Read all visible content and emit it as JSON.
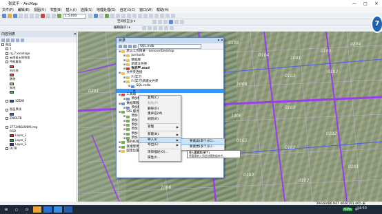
{
  "window": {
    "title": "张武平 - ArcMap",
    "minimize": "—",
    "maximize": "□",
    "close": "✕"
  },
  "menubar": [
    "文件(F)",
    "编辑(E)",
    "视图(V)",
    "书签(B)",
    "插入(I)",
    "选择(S)",
    "地理处理(G)",
    "自定义(C)",
    "窗口(W)",
    "帮助(H)"
  ],
  "toolbar": {
    "scale": "1:5,000",
    "spatial_adjust": "空间校正(J) ▾",
    "georef": "编辑器(R) ▾"
  },
  "toc": {
    "title": "内容列表",
    "layers": [
      {
        "label": "图层",
        "level": 0,
        "swatch": null
      },
      {
        "label": "1",
        "level": 1,
        "swatch": null
      },
      {
        "label": "rq_7.xxxxlogo",
        "level": 1,
        "swatch": null
      },
      {
        "label": "云南省土地利用",
        "level": 1,
        "swatch": null
      },
      {
        "label": "不能重描",
        "level": 1,
        "swatch": null
      },
      {
        "label": "",
        "level": 2,
        "swatch": "#e05050"
      },
      {
        "label": "村庄地",
        "level": 2,
        "swatch": null
      },
      {
        "label": "",
        "level": 2,
        "swatch": "#e05050"
      },
      {
        "label": "耕地",
        "level": 2,
        "swatch": null
      },
      {
        "label": "",
        "level": 2,
        "swatch": "#a0d070"
      },
      {
        "label": "林地",
        "level": 2,
        "swatch": null
      },
      {
        "label": "",
        "level": 2,
        "swatch": "#50b050"
      },
      {
        "label": "",
        "level": 2,
        "swatch": null
      },
      {
        "label": "XZDW",
        "level": 1,
        "swatch": "#2050c0"
      },
      {
        "label": "",
        "level": 2,
        "swatch": null
      },
      {
        "label": "图层界线",
        "level": 1,
        "swatch": null
      },
      {
        "label": "",
        "level": 2,
        "swatch": "#3060d0"
      },
      {
        "label": "ZWDLTB",
        "level": 1,
        "swatch": null
      },
      {
        "label": "",
        "level": 2,
        "swatch": null
      },
      {
        "label": "3771AN1000M.img",
        "level": 1,
        "swatch": null
      },
      {
        "label": "RGB",
        "level": 2,
        "swatch": null
      },
      {
        "label": "Layer_1",
        "level": 2,
        "swatch": "#e03030"
      },
      {
        "label": "Layer_2",
        "level": 2,
        "swatch": "#30a030"
      },
      {
        "label": "Layer_3",
        "level": 2,
        "swatch": "#3030d0"
      },
      {
        "label": "DLTB",
        "level": 1,
        "swatch": null
      }
    ]
  },
  "catalog": {
    "title": "目录",
    "location": "SQL.mdb",
    "tree": [
      {
        "label": "默认工作目录 - Lenovo\\Desktop",
        "level": 0,
        "icon": "folder"
      },
      {
        "label": "junliuofz",
        "level": 1,
        "icon": "folder"
      },
      {
        "label": "数据库",
        "level": 1,
        "icon": "folder"
      },
      {
        "label": "新建文件夹",
        "level": 1,
        "icon": "folder"
      },
      {
        "label": "张武平.mxd",
        "level": 1,
        "icon": "mxd"
      },
      {
        "label": "文件夹连接",
        "level": 0,
        "icon": "folder"
      },
      {
        "label": "F:\\实习",
        "level": 1,
        "icon": "folder"
      },
      {
        "label": "F:\\实习\\新建文件夹",
        "level": 1,
        "icon": "folder"
      },
      {
        "label": "SQL.mdb",
        "level": 2,
        "icon": "db"
      },
      {
        "label": "",
        "level": 3,
        "icon": "db"
      },
      {
        "label": "工具箱",
        "level": 0,
        "icon": "tool"
      },
      {
        "label": "添加数",
        "level": 1,
        "icon": "db"
      },
      {
        "label": "数据库服",
        "level": 0,
        "icon": "db"
      },
      {
        "label": "添加数",
        "level": 1,
        "icon": "db"
      },
      {
        "label": "GIS 服务",
        "level": 0,
        "icon": "gis"
      },
      {
        "label": "添加 A",
        "level": 1,
        "icon": "gis"
      },
      {
        "label": "添加 A",
        "level": 1,
        "icon": "gis"
      },
      {
        "label": "添加 A",
        "level": 1,
        "icon": "gis"
      },
      {
        "label": "添加 V",
        "level": 1,
        "icon": "gis"
      },
      {
        "label": "添加 V",
        "level": 1,
        "icon": "gis"
      },
      {
        "label": "添加 S",
        "level": 1,
        "icon": "gis"
      },
      {
        "label": "我的托管",
        "level": 0,
        "icon": "gis"
      },
      {
        "label": "就绪使用",
        "level": 0,
        "icon": "gis"
      },
      {
        "label": "固定位置",
        "level": 0,
        "icon": "folder"
      }
    ]
  },
  "context_menu": {
    "items": [
      {
        "label": "复制(C)",
        "disabled": false,
        "submenu": false
      },
      {
        "label": "粘贴(P)",
        "disabled": true,
        "submenu": false
      },
      {
        "label": "删除(D)",
        "disabled": false,
        "submenu": false
      },
      {
        "label": "重命名(M)",
        "disabled": false,
        "submenu": false
      },
      {
        "label": "刷新(R)",
        "disabled": false,
        "submenu": false
      },
      {
        "sep": true
      },
      {
        "label": "管理",
        "disabled": false,
        "submenu": true
      },
      {
        "sep": true
      },
      {
        "label": "新建(N)",
        "disabled": false,
        "submenu": true
      },
      {
        "label": "导入(I)",
        "disabled": false,
        "submenu": true,
        "highlight": true
      },
      {
        "label": "导出(E)",
        "disabled": false,
        "submenu": true
      },
      {
        "sep": true
      },
      {
        "label": "项目描述(O)...",
        "disabled": false,
        "submenu": false
      },
      {
        "label": "属性(I)...",
        "disabled": false,
        "submenu": false
      }
    ]
  },
  "submenu": {
    "items": [
      {
        "label": "要素类(单个)(C)...",
        "highlight": true
      },
      {
        "label": "要素类(多个)(L)...",
        "highlight": false
      }
    ]
  },
  "tooltip": {
    "line1": "导入要素类(单个)",
    "line2": "将要素转入到此地理数据库中。"
  },
  "map": {
    "parcel_labels": [
      "0103",
      "0108",
      "0104",
      "1001",
      "0103",
      "0204",
      "0103",
      "1006",
      "0103",
      "0102",
      "0201",
      "0102",
      "0104",
      "1006",
      "0103",
      "0102",
      "0103",
      "0102",
      "0203",
      "0103",
      "0103",
      "0102",
      "0101",
      "1006"
    ]
  },
  "status": {
    "coords": "39446486.947  4040191.465 米"
  },
  "taskbar": {
    "time": "14:53",
    "battery": "93%",
    "start": "⊞",
    "search": "○",
    "taskview": "⊡",
    "ime": "中"
  }
}
